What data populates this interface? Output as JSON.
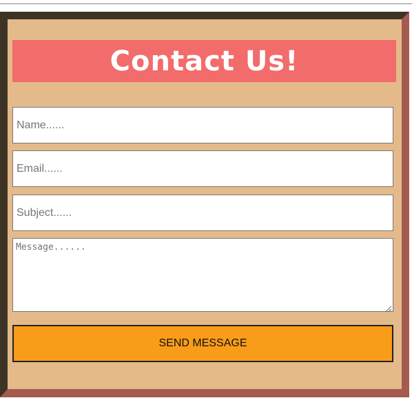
{
  "contact_form": {
    "title": "Contact Us!",
    "name_placeholder": "Name......",
    "email_placeholder": "Email......",
    "subject_placeholder": "Subject......",
    "message_placeholder": "Message......",
    "send_label": "SEND MESSAGE"
  },
  "colors": {
    "page_background": "#ffffff",
    "frame_fill": "#e4ba8b",
    "frame_border_dark": "#3e3426",
    "frame_border_light": "#a35b4f",
    "title_background": "#f26c6c",
    "title_text": "#ffffff",
    "button_background": "#f99c19"
  },
  "icons": {
    "textarea_resize": "resize-grip-icon"
  }
}
